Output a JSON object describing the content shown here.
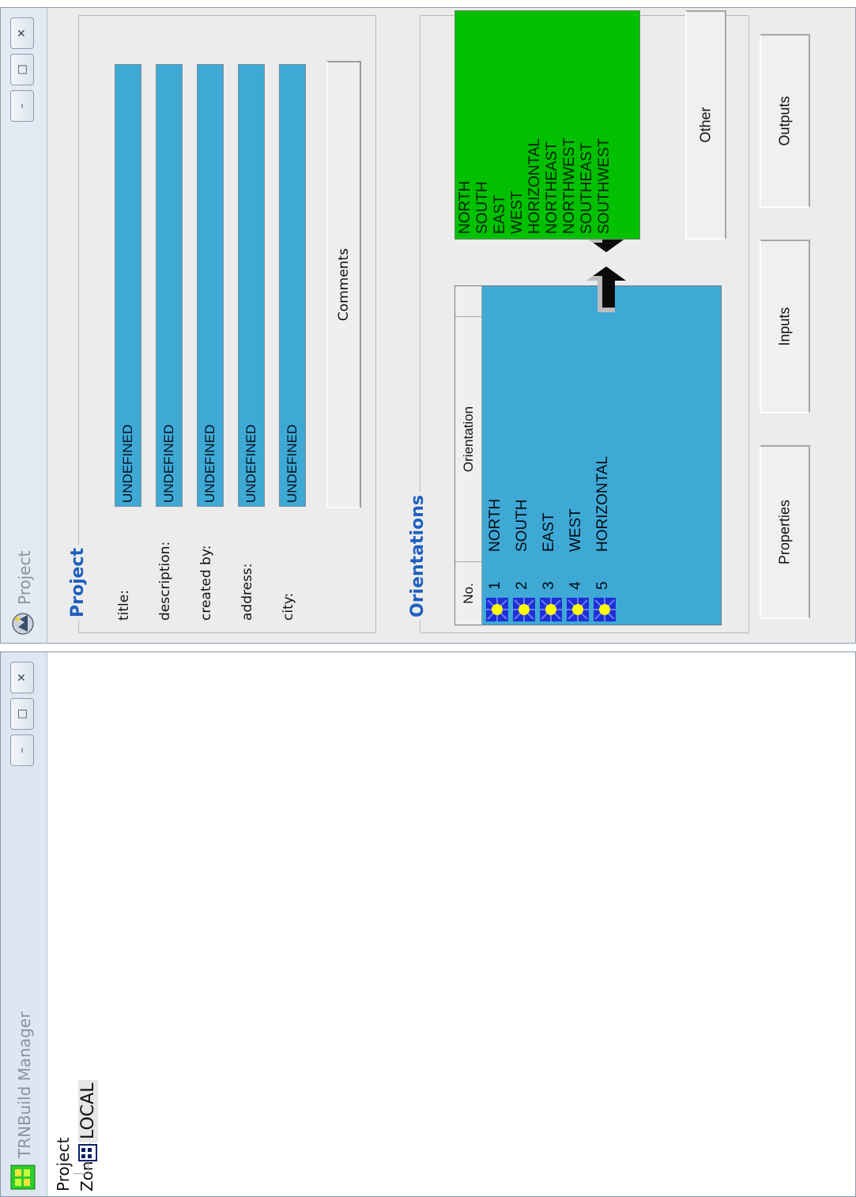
{
  "manager": {
    "title": "TRNBuild Manager",
    "tree": {
      "root": "Project",
      "zones": "Zones",
      "zone_item": "LOCAL"
    },
    "controls": {
      "minimize": "–",
      "maximize": "□",
      "close": "✕"
    }
  },
  "project_window": {
    "title": "Project",
    "controls": {
      "minimize": "–",
      "maximize": "□",
      "close": "✕"
    },
    "project_group": {
      "title": "Project",
      "fields": [
        {
          "label": "title:",
          "value": "UNDEFINED"
        },
        {
          "label": "description:",
          "value": "UNDEFINED"
        },
        {
          "label": "created by:",
          "value": "UNDEFINED"
        },
        {
          "label": "address:",
          "value": "UNDEFINED"
        },
        {
          "label": "city:",
          "value": "UNDEFINED"
        }
      ],
      "comments_button": "Comments"
    },
    "orientations_group": {
      "title": "Orientations",
      "table_headers": {
        "no": "No.",
        "orientation": "Orientation"
      },
      "rows": [
        {
          "no": "1",
          "orientation": "NORTH"
        },
        {
          "no": "2",
          "orientation": "SOUTH"
        },
        {
          "no": "3",
          "orientation": "EAST"
        },
        {
          "no": "4",
          "orientation": "WEST"
        },
        {
          "no": "5",
          "orientation": "HORIZONTAL"
        }
      ],
      "available": [
        "NORTH",
        "SOUTH",
        "EAST",
        "WEST",
        "HORIZONTAL",
        "NORTHEAST",
        "NORTHWEST",
        "SOUTHEAST",
        "SOUTHWEST"
      ],
      "other_button": "Other"
    },
    "bottom_buttons": {
      "properties": "Properties",
      "inputs": "Inputs",
      "outputs": "Outputs"
    },
    "colors": {
      "field_blue": "#3fa9d6",
      "list_green": "#00c000",
      "group_title_blue": "#1f5fbf"
    }
  }
}
